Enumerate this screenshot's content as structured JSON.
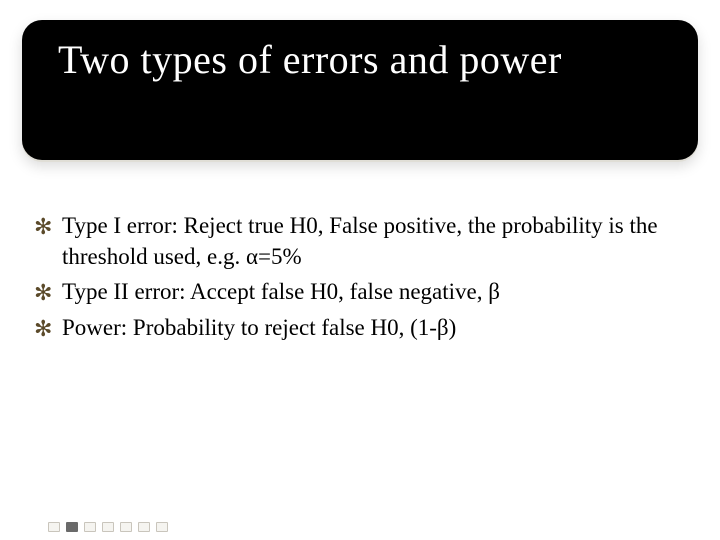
{
  "title": "Two types of errors and power",
  "bullets": [
    "Type I error: Reject true H0, False positive, the probability is the threshold used, e.g. α=5%",
    "Type II error: Accept false H0, false negative, β",
    "Power: Probability to reject false H0, (1-β)"
  ],
  "bullet_glyph": "✻"
}
